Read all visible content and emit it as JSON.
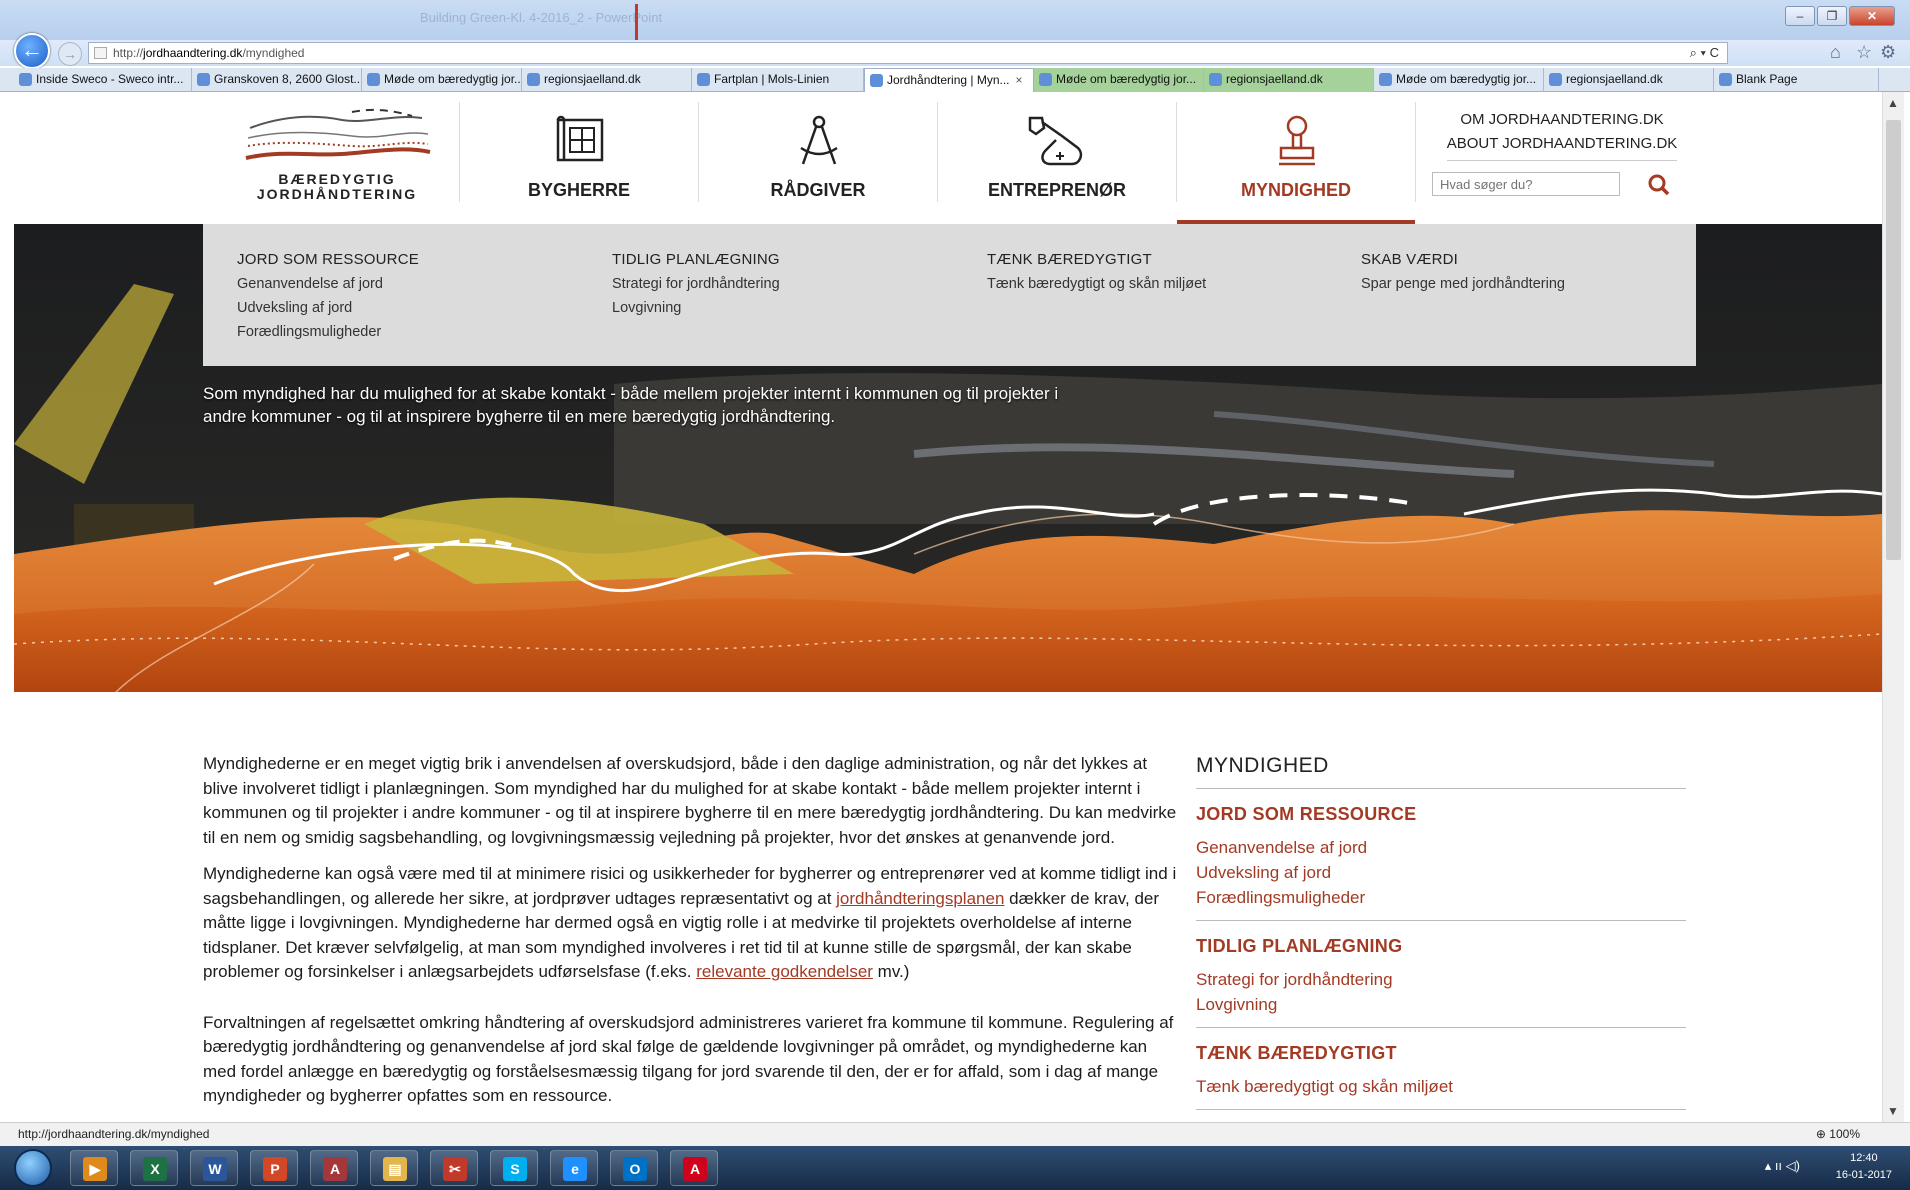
{
  "browser": {
    "window_title": "Building Green-Kl. 4-2016_2 - PowerPoint",
    "url_prefix": "http://",
    "url_host": "jordhaandtering.dk",
    "url_path": "/myndighed",
    "address_controls": "⌕ ▾ C",
    "tabs": [
      {
        "label": "Inside Sweco - Sweco intr...",
        "style": "normal"
      },
      {
        "label": "Granskoven 8, 2600 Glost...",
        "style": "normal"
      },
      {
        "label": "Møde om bæredygtig jor...",
        "style": "normal"
      },
      {
        "label": "regionsjaelland.dk",
        "style": "normal"
      },
      {
        "label": "Fartplan | Mols-Linien",
        "style": "normal"
      },
      {
        "label": "Jordhåndtering | Myn...",
        "style": "active",
        "close": "×"
      },
      {
        "label": "Møde om bæredygtig jor...",
        "style": "green"
      },
      {
        "label": "regionsjaelland.dk",
        "style": "green"
      },
      {
        "label": "Møde om bæredygtig jor...",
        "style": "normal"
      },
      {
        "label": "regionsjaelland.dk",
        "style": "normal"
      },
      {
        "label": "Blank Page",
        "style": "normal"
      }
    ],
    "status_url": "http://jordhaandtering.dk/myndighed",
    "zoom": "100%"
  },
  "site": {
    "logo_line1": "BÆREDYGTIG",
    "logo_line2": "JORDHÅNDTERING",
    "nav": [
      {
        "label": "BYGHERRE",
        "icon": "blueprint-icon"
      },
      {
        "label": "RÅDGIVER",
        "icon": "compass-icon"
      },
      {
        "label": "ENTREPRENØR",
        "icon": "excavator-icon"
      },
      {
        "label": "MYNDIGHED",
        "icon": "stamp-icon",
        "active": true
      }
    ],
    "about1": "OM JORDHAANDTERING.DK",
    "about2": "ABOUT JORDHAANDTERING.DK",
    "search_placeholder": "Hvad søger du?",
    "accent": "#a33a24"
  },
  "megamenu": {
    "cols": [
      {
        "head": "JORD SOM RESSOURCE",
        "items": [
          "Genanvendelse af jord",
          "Udveksling af jord",
          "Forædlingsmuligheder"
        ]
      },
      {
        "head": "TIDLIG PLANLÆGNING",
        "items": [
          "Strategi for jordhåndtering",
          "Lovgivning"
        ]
      },
      {
        "head": "TÆNK BÆREDYGTIGT",
        "items": [
          "Tænk bæredygtigt og skån miljøet"
        ]
      },
      {
        "head": "SKAB VÆRDI",
        "items": [
          "Spar penge med jordhåndtering"
        ]
      }
    ]
  },
  "hero": {
    "line1": "Som myndighed har du mulighed for at skabe kontakt - både mellem projekter internt i kommunen og til projekter i",
    "line2": "andre kommuner - og til at inspirere bygherre til en mere bæredygtig jordhåndtering."
  },
  "content": {
    "p1": "Myndighederne er en meget vigtig brik i anvendelsen af overskudsjord, både i den daglige administration, og når det lykkes at blive involveret tidligt i planlægningen. Som myndighed har du mulighed for at skabe kontakt - både mellem projekter internt i kommunen og til projekter i andre kommuner - og til at inspirere bygherre til en mere bæredygtig jordhåndtering. Du kan medvirke til en nem og smidig sagsbehandling, og lovgivningsmæssig vejledning på projekter, hvor det ønskes at genanvende jord.",
    "p2a": "Myndighederne kan også være med til at minimere risici og usikkerheder for bygherrer og entreprenører ved at komme tidligt ind i sagsbehandlingen, og allerede her sikre, at jordprøver udtages repræsentativt og at ",
    "p2link1": "jordhåndteringsplanen",
    "p2b": " dækker de krav, der måtte ligge i lovgivningen. Myndighederne har dermed også en vigtig rolle i at medvirke til projektets overholdelse af interne tidsplaner. Det kræver selvfølgelig, at man som myndighed involveres i ret tid til at kunne stille de spørgsmål, der kan skabe problemer og forsinkelser i anlægsarbejdets udførselsfase (f.eks. ",
    "p2link2": "relevante godkendelser",
    "p2c": " mv.)",
    "p3": "Forvaltningen af regelsættet omkring håndtering af overskudsjord administreres varieret fra kommune til kommune. Regulering af bæredygtig jordhåndtering og genanvendelse af jord skal følge de gældende lovgivninger på området, og myndighederne kan med fordel anlægge en bæredygtig og forståelsesmæssig tilgang for jord svarende til den, der er for affald, som i dag af mange myndigheder og bygherrer opfattes som en ressource."
  },
  "sidebar": {
    "title": "MYNDIGHED",
    "sections": [
      {
        "head": "JORD SOM RESSOURCE",
        "links": [
          "Genanvendelse af jord",
          "Udveksling af jord",
          "Forædlingsmuligheder"
        ]
      },
      {
        "head": "TIDLIG PLANLÆGNING",
        "links": [
          "Strategi for jordhåndtering",
          "Lovgivning"
        ]
      },
      {
        "head": "TÆNK BÆREDYGTIGT",
        "links": [
          "Tænk bæredygtigt og skån miljøet"
        ]
      }
    ]
  },
  "taskbar": {
    "apps": [
      {
        "icon": "media-player-icon",
        "glyph": "▶",
        "color": "#e08a1c"
      },
      {
        "icon": "excel-icon",
        "glyph": "X",
        "color": "#1e7145"
      },
      {
        "icon": "word-icon",
        "glyph": "W",
        "color": "#2b579a"
      },
      {
        "icon": "powerpoint-icon",
        "glyph": "P",
        "color": "#d24726"
      },
      {
        "icon": "access-icon",
        "glyph": "A",
        "color": "#a4373a"
      },
      {
        "icon": "file-explorer-icon",
        "glyph": "▤",
        "color": "#e3b64c"
      },
      {
        "icon": "snipping-tool-icon",
        "glyph": "✂",
        "color": "#c0392b"
      },
      {
        "icon": "skype-icon",
        "glyph": "S",
        "color": "#00aff0"
      },
      {
        "icon": "internet-explorer-icon",
        "glyph": "e",
        "color": "#1e90ff"
      },
      {
        "icon": "outlook-icon",
        "glyph": "O",
        "color": "#0072c6"
      },
      {
        "icon": "acrobat-icon",
        "glyph": "A",
        "color": "#d0021b"
      }
    ],
    "time": "12:40",
    "date": "16-01-2017"
  }
}
